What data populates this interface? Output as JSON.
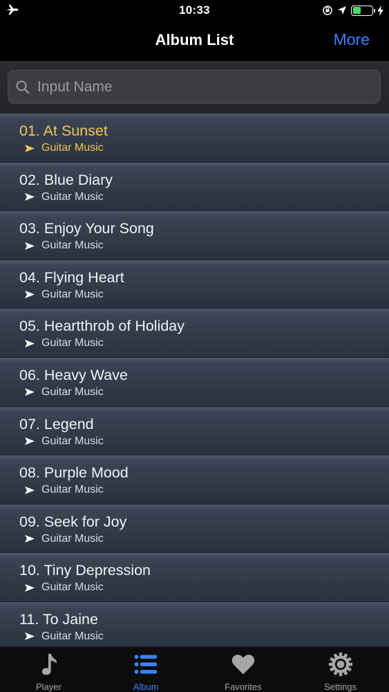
{
  "status_bar": {
    "time": "10:33"
  },
  "nav": {
    "title": "Album List",
    "more_label": "More"
  },
  "search": {
    "placeholder": "Input Name"
  },
  "albums": [
    {
      "title": "01. At Sunset",
      "genre": "Guitar Music",
      "active": true
    },
    {
      "title": "02. Blue Diary",
      "genre": "Guitar Music"
    },
    {
      "title": "03. Enjoy Your Song",
      "genre": "Guitar Music"
    },
    {
      "title": "04. Flying Heart",
      "genre": "Guitar Music"
    },
    {
      "title": "05. Heartthrob of Holiday",
      "genre": "Guitar Music"
    },
    {
      "title": "06. Heavy Wave",
      "genre": "Guitar Music"
    },
    {
      "title": "07. Legend",
      "genre": "Guitar Music"
    },
    {
      "title": "08. Purple Mood",
      "genre": "Guitar Music"
    },
    {
      "title": "09. Seek for Joy",
      "genre": "Guitar Music"
    },
    {
      "title": "10. Tiny Depression",
      "genre": "Guitar Music"
    },
    {
      "title": "11. To Jaine",
      "genre": "Guitar Music"
    }
  ],
  "tabs": [
    {
      "label": "Player",
      "icon": "music-note-icon"
    },
    {
      "label": "Album",
      "icon": "list-icon",
      "active": true
    },
    {
      "label": "Favorites",
      "icon": "heart-icon"
    },
    {
      "label": "Settings",
      "icon": "gear-icon"
    }
  ],
  "colors": {
    "accent": "#3a82f7",
    "active_row": "#f5c451",
    "battery": "#4cd964"
  }
}
